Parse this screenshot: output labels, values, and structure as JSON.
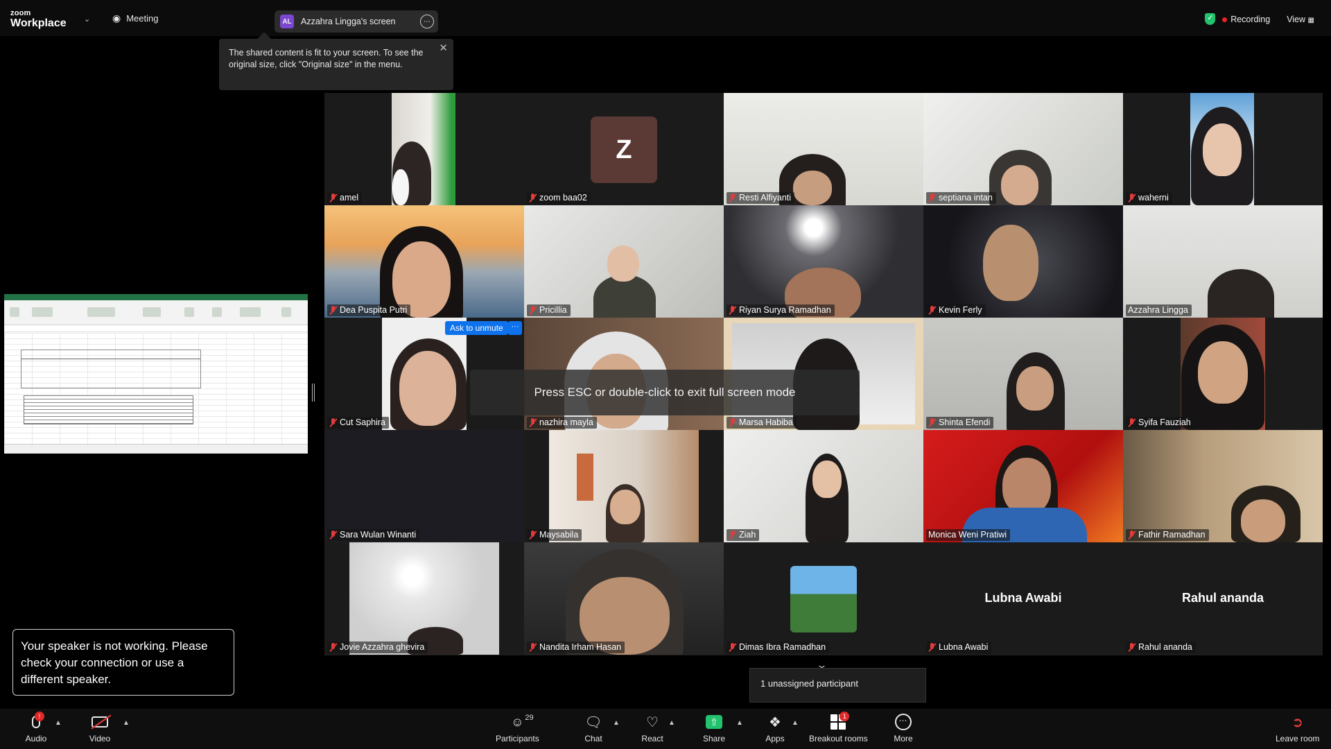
{
  "topbar": {
    "logo_line1": "zoom",
    "logo_line2": "Workplace",
    "meeting_label": "Meeting",
    "share_initials": "AL",
    "share_label": "Azzahra Lingga's screen",
    "recording_label": "Recording",
    "view_label": "View"
  },
  "tooltip": {
    "text": "The shared content is fit to your screen. To see the original size, click \"Original size\" in the menu."
  },
  "gallery": {
    "participants": [
      {
        "name": "amel",
        "muted": true
      },
      {
        "name": "zoom baa02",
        "muted": true,
        "avatar_letter": "Z"
      },
      {
        "name": "Resti Alfiyanti",
        "muted": true
      },
      {
        "name": "septiana intan",
        "muted": true
      },
      {
        "name": "waherni",
        "muted": true
      },
      {
        "name": "Dea Puspita Putri",
        "muted": true
      },
      {
        "name": "Pricillia",
        "muted": true
      },
      {
        "name": "Riyan Surya Ramadhan",
        "muted": true
      },
      {
        "name": "Kevin Ferly",
        "muted": true
      },
      {
        "name": "Azzahra Lingga",
        "muted": false,
        "active_speaker": true
      },
      {
        "name": "Cut Saphira",
        "muted": true
      },
      {
        "name": "nazhira mayla",
        "muted": true
      },
      {
        "name": "Marsa Habiba",
        "muted": true
      },
      {
        "name": "Shinta Efendi",
        "muted": true
      },
      {
        "name": "Syifa Fauziah",
        "muted": true
      },
      {
        "name": "Sara Wulan Winanti",
        "muted": true
      },
      {
        "name": "Maysabila",
        "muted": true
      },
      {
        "name": "Ziah",
        "muted": true
      },
      {
        "name": "Monica Weni Pratiwi",
        "muted": false
      },
      {
        "name": "Fathir Ramadhan",
        "muted": true
      },
      {
        "name": "Jovie Azzahra ghevira",
        "muted": true
      },
      {
        "name": "Nandita Irham Hasan",
        "muted": true
      },
      {
        "name": "Dimas Ibra Ramadhan",
        "muted": true
      },
      {
        "name": "Lubna Awabi",
        "muted": true,
        "big_name": "Lubna Awabi"
      },
      {
        "name": "Rahul ananda",
        "muted": true,
        "big_name": "Rahul ananda"
      }
    ],
    "ask_to_unmute_label": "Ask to unmute",
    "ask_more_label": "···",
    "esc_banner": "Press ESC or double-click to exit full screen mode"
  },
  "speaker_warning": "Your speaker is not working. Please check your connection or use a different speaker.",
  "unassigned": "1 unassigned participant",
  "toolbar": {
    "audio_label": "Audio",
    "video_label": "Video",
    "participants_label": "Participants",
    "participants_count": "29",
    "chat_label": "Chat",
    "react_label": "React",
    "share_label": "Share",
    "apps_label": "Apps",
    "breakout_label": "Breakout rooms",
    "breakout_badge": "1",
    "more_label": "More",
    "leave_label": "Leave room"
  },
  "colors": {
    "accent_blue": "#0e72ed",
    "share_green": "#23c36e",
    "muted_red": "#e23b3b",
    "active_speaker_outline": "#2fc07a"
  }
}
